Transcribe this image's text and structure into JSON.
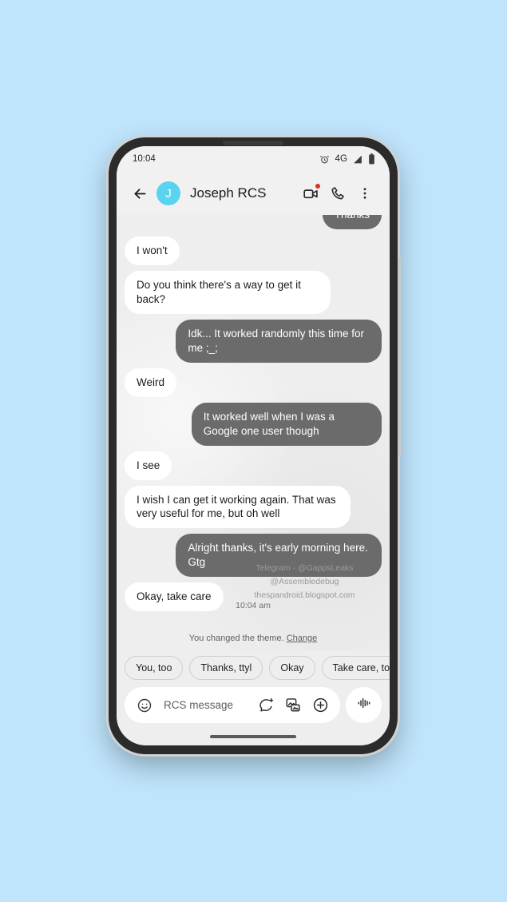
{
  "status_bar": {
    "time": "10:04",
    "network": "4G",
    "icons": [
      "alarm-icon",
      "signal-icon",
      "battery-icon"
    ]
  },
  "app_bar": {
    "back_icon": "back-arrow-icon",
    "avatar_initial": "J",
    "avatar_color": "#5ad3f0",
    "contact_name": "Joseph RCS",
    "video_call_icon": "video-call-icon",
    "video_call_badge_color": "#d93025",
    "phone_call_icon": "phone-call-icon",
    "overflow_icon": "more-vertical-icon"
  },
  "conversation": {
    "messages": [
      {
        "text": "Thanks",
        "side": "out",
        "clipped": true
      },
      {
        "text": "I won't",
        "side": "in",
        "clipped": false
      },
      {
        "text": "Do you think there's a way to get it back?",
        "side": "in",
        "clipped": false
      },
      {
        "text": "Idk... It worked randomly this time for me ;_;",
        "side": "out",
        "clipped": false
      },
      {
        "text": "Weird",
        "side": "in",
        "clipped": false
      },
      {
        "text": "It worked well when I was a Google one user though",
        "side": "out",
        "clipped": false
      },
      {
        "text": "I see",
        "side": "in",
        "clipped": false
      },
      {
        "text": "I wish I can get it working again. That was very useful for me, but oh well",
        "side": "in",
        "clipped": false
      },
      {
        "text": "Alright thanks, it's early morning here. Gtg",
        "side": "out",
        "clipped": false
      },
      {
        "text": "Okay, take care",
        "side": "in",
        "clipped": false
      }
    ],
    "watermark": {
      "line1": "Telegram - @GappsLeaks",
      "line2": "@Assembledebug",
      "line3": "thespandroid.blogspot.com"
    },
    "timestamp": "10:04 am",
    "theme_notice": {
      "text": "You changed the theme.",
      "link_label": "Change"
    }
  },
  "suggestions": {
    "chips": [
      "You, too",
      "Thanks, ttyl",
      "Okay",
      "Take care, too"
    ]
  },
  "input_bar": {
    "emoji_icon": "emoji-smiley-icon",
    "placeholder": "RCS message",
    "magic_compose_icon": "magic-compose-icon",
    "gallery_icon": "gallery-icon",
    "plus_icon": "plus-circle-icon",
    "voice_icon": "voice-waveform-icon"
  },
  "colors": {
    "page_background": "#bfe4fb",
    "chat_background": "#eeeeee",
    "incoming_bubble": "#ffffff",
    "outgoing_bubble": "#6b6b6b",
    "app_bar": "#f1f1f1"
  }
}
